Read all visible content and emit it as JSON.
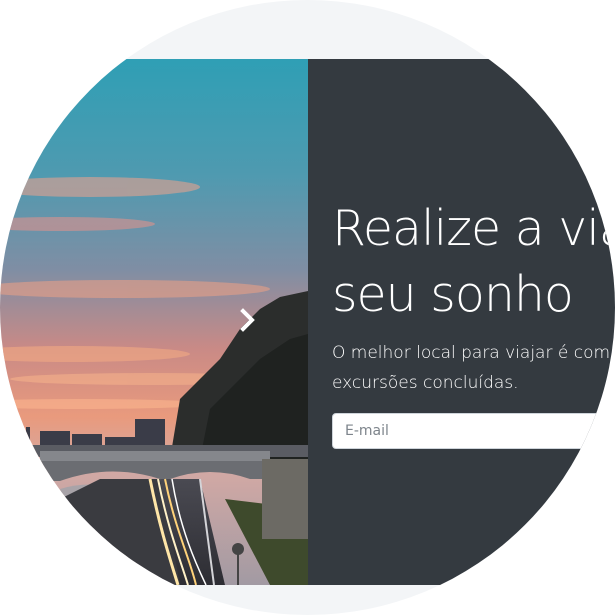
{
  "hero": {
    "headline_line1": "Realize a via",
    "headline_line2": "seu sonho",
    "lead_line1": "O melhor local para viajar é com",
    "lead_line2": "excursões concluídas."
  },
  "signup": {
    "email_placeholder": "E-mail"
  },
  "carousel": {
    "next_icon": "chevron-right-icon"
  },
  "colors": {
    "panel_background": "#343a40",
    "page_background": "#f3f5f7",
    "text": "#ffffff"
  }
}
